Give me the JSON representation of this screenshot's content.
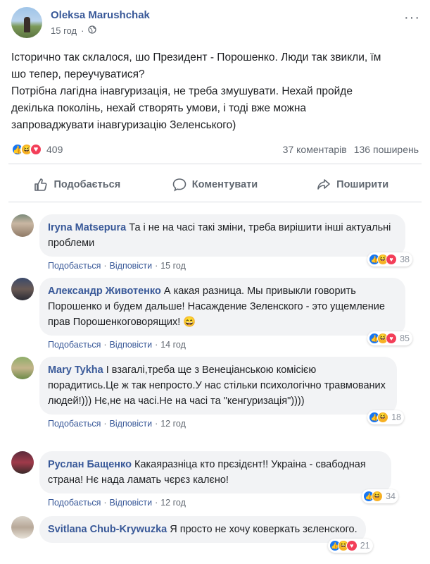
{
  "post": {
    "author": "Oleksa Marushchak",
    "time": "15 год",
    "text_lines": [
      "Історично так склалося, шо Президент - Порошенко. Люди так звикли, їм",
      "шо тепер, переучуватися?",
      "Потрібна лагідна інавгуризація, не треба змушувати. Нехай пройде",
      "декілька поколінь, нехай створять умови, і тоді вже можна",
      "запроваджувати інавгуризацію Зеленського)"
    ],
    "reaction_count": "409",
    "comments_count": "37 коментарів",
    "shares_count": "136 поширень"
  },
  "actions": {
    "like": "Подобається",
    "comment": "Коментувати",
    "share": "Поширити"
  },
  "comment_links": {
    "like": "Подобається",
    "reply": "Відповісти",
    "separator": "·"
  },
  "comments": [
    {
      "name": "Iryna Matsepura",
      "text": "Та і не на часі такі зміни, треба вирішити інші актуальні проблеми",
      "reactions": "38",
      "time": "15 год"
    },
    {
      "name": "Александр Животенко",
      "text": "А какая разница. Мы привыкли говорить Порошенко и будем дальше! Насаждение Зеленского - это ущемление прав Порошенкоговорящих! 😄",
      "reactions": "85",
      "time": "14 год"
    },
    {
      "name": "Mary Tykha",
      "text": "І взагалі,треба ще з Венеціанською комісією порадитись.Це ж так непросто.У нас стільки психологічно травмованих людей!))) Нє,не на часі.Не на часі та \"кенгуризація\"))))",
      "reactions": "18",
      "time": "12 год"
    },
    {
      "name": "Руслан Бащенко",
      "text": "Какаяразніца кто прєзідєнт!! Украіна - свабодная страна! Нє нада ламать чєрєз калєно!",
      "reactions": "34",
      "time": "12 год"
    },
    {
      "name": "Svitlana Chub-Krywuzka",
      "text": "Я просто не хочу коверкать зєленского.",
      "reactions": "21",
      "time": ""
    }
  ],
  "colors": {
    "link": "#385898",
    "like": "#1877f2",
    "haha": "#f7b125",
    "love": "#f33e58",
    "bubble": "#f2f3f5"
  }
}
